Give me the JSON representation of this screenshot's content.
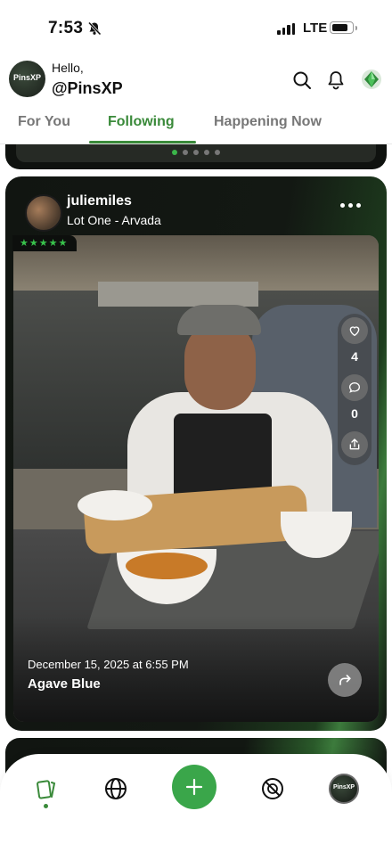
{
  "status_bar": {
    "time": "7:53",
    "network": "LTE"
  },
  "header": {
    "greeting": "Hello,",
    "username": "@PinsXP",
    "logo_text": "PinsXP"
  },
  "tabs": [
    {
      "label": "For You",
      "active": false
    },
    {
      "label": "Following",
      "active": true
    },
    {
      "label": "Happening Now",
      "active": false
    }
  ],
  "post": {
    "author": "juliemiles",
    "location": "Lot One - Arvada",
    "rating": 5,
    "stars_text": "★★★★★",
    "likes": "4",
    "comments": "0",
    "date": "December 15, 2025 at 6:55 PM",
    "title": "Agave Blue"
  },
  "bottom_nav": {
    "profile_logo_text": "PinsXP"
  },
  "colors": {
    "accent": "#3a8a3a",
    "fab": "#3aa64a",
    "star": "#38c24b"
  }
}
